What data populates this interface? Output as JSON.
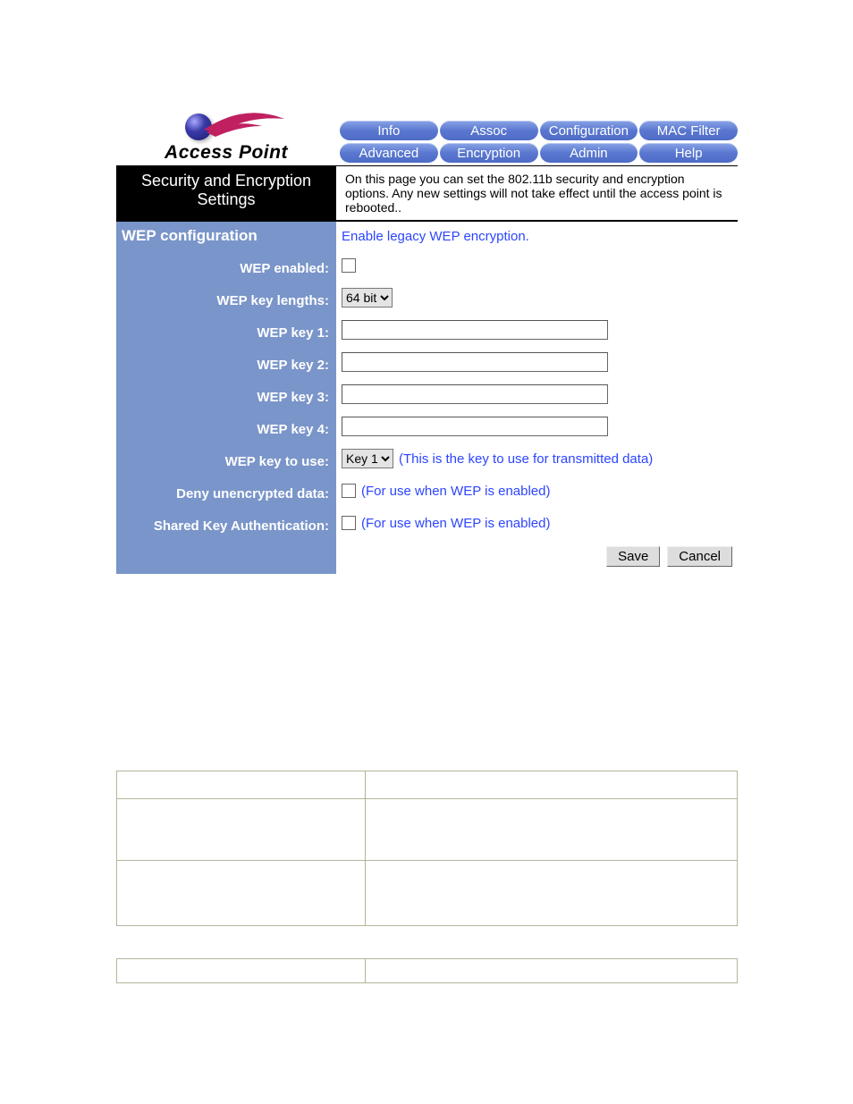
{
  "logo": {
    "text": "Access Point"
  },
  "nav": {
    "row1": [
      "Info",
      "Assoc",
      "Configuration",
      "MAC Filter"
    ],
    "row2": [
      "Advanced",
      "Encryption",
      "Admin",
      "Help"
    ]
  },
  "title": {
    "heading": "Security and Encryption Settings",
    "description": "On this page you can set the 802.11b security and encryption options. Any new settings will not take effect until the access point is rebooted.."
  },
  "section": {
    "name": "WEP configuration",
    "desc": "Enable legacy WEP encryption."
  },
  "form": {
    "wep_enabled_label": "WEP enabled:",
    "wep_key_lengths_label": "WEP key lengths:",
    "wep_key_lengths_value": "64 bit",
    "wep_key1_label": "WEP key 1:",
    "wep_key1_value": "",
    "wep_key2_label": "WEP key 2:",
    "wep_key2_value": "",
    "wep_key3_label": "WEP key 3:",
    "wep_key3_value": "",
    "wep_key4_label": "WEP key 4:",
    "wep_key4_value": "",
    "wep_key_use_label": "WEP key to use:",
    "wep_key_use_value": "Key 1",
    "wep_key_use_hint": "(This is the key to use for transmitted data)",
    "deny_label": "Deny unencrypted data:",
    "deny_hint": "(For use when WEP is enabled)",
    "shared_label": "Shared Key Authentication:",
    "shared_hint": "(For use when WEP is enabled)"
  },
  "buttons": {
    "save": "Save",
    "cancel": "Cancel"
  }
}
